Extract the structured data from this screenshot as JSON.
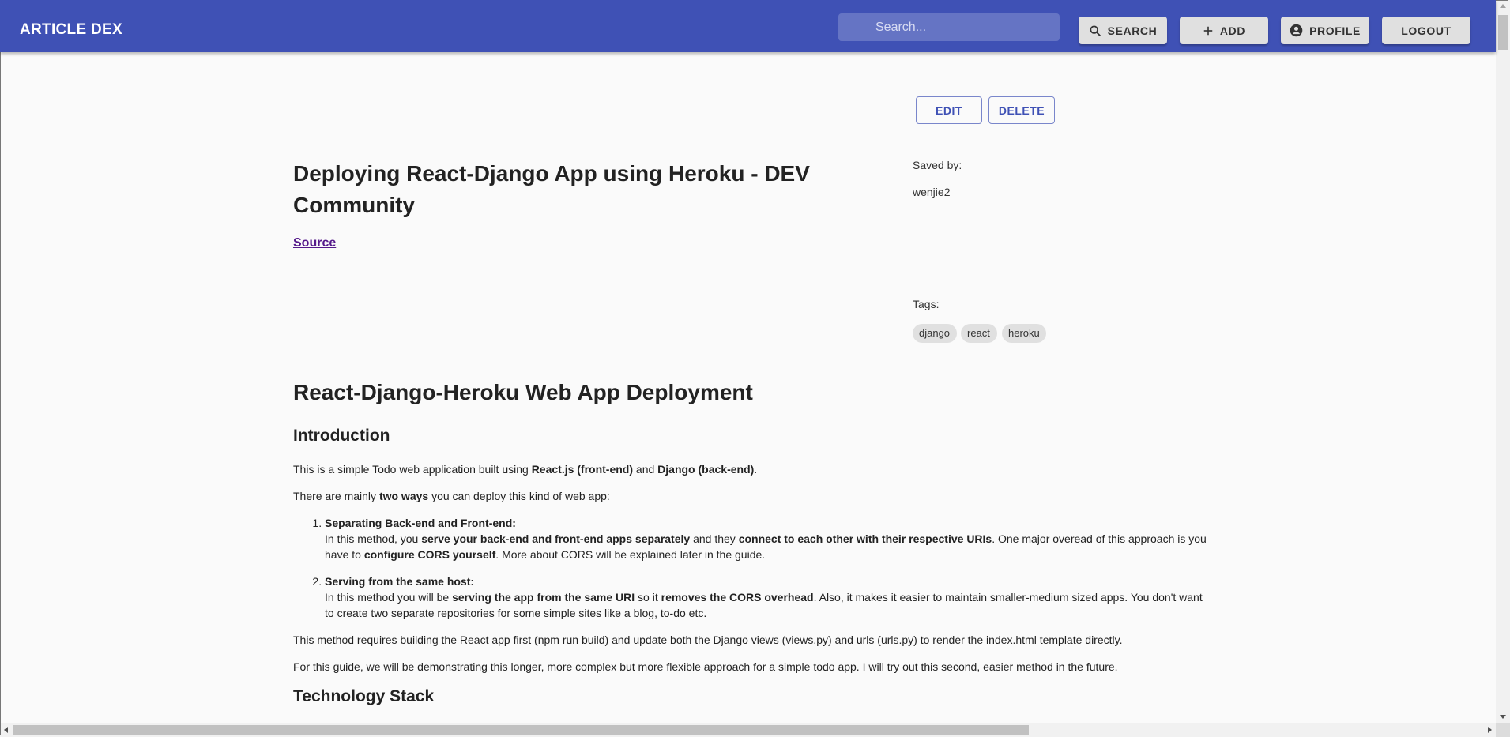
{
  "app": {
    "brand": "ARTICLE DEX"
  },
  "search": {
    "placeholder": "Search..."
  },
  "nav": {
    "search_label": "SEARCH",
    "add_label": "ADD",
    "profile_label": "PROFILE",
    "logout_label": "LOGOUT"
  },
  "actions": {
    "edit_label": "EDIT",
    "delete_label": "DELETE"
  },
  "article": {
    "title": "Deploying React-Django App using Heroku - DEV Community",
    "source_label": "Source",
    "saved_by_label": "Saved by:",
    "saved_by_user": "wenjie2",
    "tags_label": "Tags:",
    "tags": [
      "django",
      "react",
      "heroku"
    ]
  },
  "content": {
    "h1": "React-Django-Heroku Web App Deployment",
    "intro_heading": "Introduction",
    "p1": [
      "This is a simple Todo web application built using ",
      "React.js (front-end)",
      " and ",
      "Django (back-end)",
      "."
    ],
    "p2": [
      "There are mainly ",
      "two ways",
      " you can deploy this kind of web app:"
    ],
    "item1": {
      "title": "Separating Back-end and Front-end:",
      "parts": [
        "In this method, you ",
        "serve your back-end and front-end apps separately",
        " and they ",
        "connect to each other with their respective URIs",
        ". One major overead of this approach is you have to ",
        "configure CORS yourself",
        ". More about CORS will be explained later in the guide."
      ]
    },
    "item2": {
      "title": "Serving from the same host:",
      "parts": [
        "In this method you will be ",
        "serving the app from the same URI",
        " so it ",
        "removes the CORS overhead",
        ". Also, it makes it easier to maintain smaller-medium sized apps. You don't want to create two separate repositories for some simple sites like a blog, to-do etc."
      ]
    },
    "p3": "This method requires building the React app first (npm run build) and update both the Django views (views.py) and urls (urls.py) to render the index.html template directly.",
    "p4": "For this guide, we will be demonstrating this longer, more complex but more flexible approach for a simple todo app. I will try out this second, easier method in the future.",
    "tech_heading": "Technology Stack"
  },
  "colors": {
    "appbar": "#3f51b5",
    "accent": "#3f51b5",
    "link": "#551a8b"
  }
}
